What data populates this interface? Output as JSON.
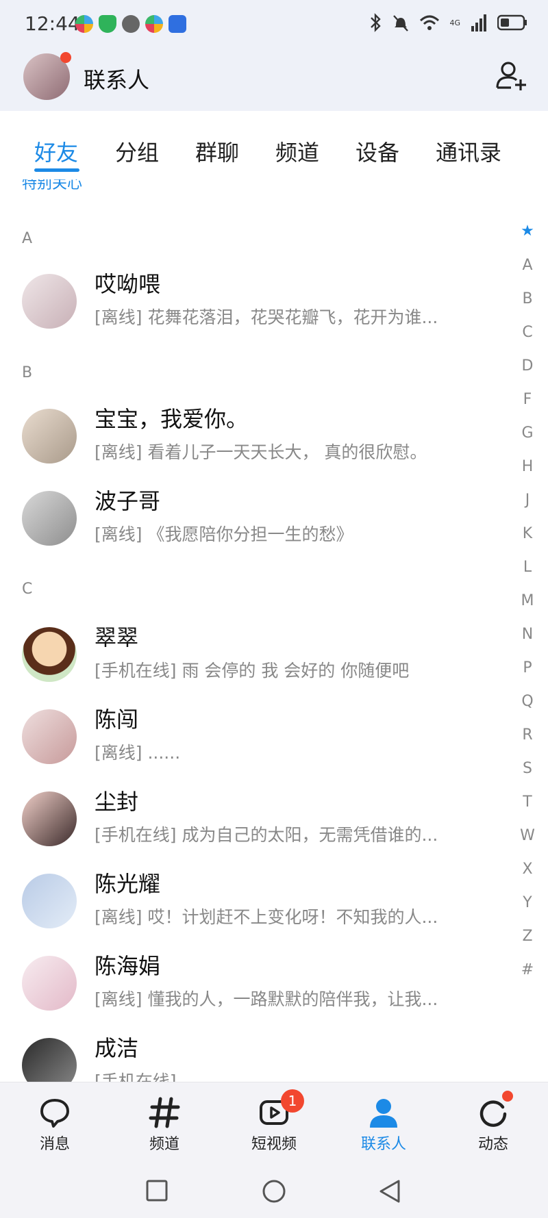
{
  "status_bar": {
    "time": "12:44",
    "network": "4G"
  },
  "header": {
    "title": "联系人"
  },
  "tabs": [
    "好友",
    "分组",
    "群聊",
    "频道",
    "设备",
    "通讯录"
  ],
  "partial_section": "特别关心",
  "sections": [
    {
      "letter": "A",
      "contacts": [
        {
          "name": "哎呦喂",
          "status": "[离线] 花舞花落泪，花哭花瓣飞，花开为谁..."
        }
      ]
    },
    {
      "letter": "B",
      "contacts": [
        {
          "name": "宝宝，我爱你。",
          "status": "[离线] 看着儿子一天天长大， 真的很欣慰。"
        },
        {
          "name": "波子哥",
          "status": "[离线] 《我愿陪你分担一生的愁》"
        }
      ]
    },
    {
      "letter": "C",
      "contacts": [
        {
          "name": "翠翠",
          "status": "[手机在线] 雨  会停的  我   会好的  你随便吧"
        },
        {
          "name": "陈闯",
          "status": "[离线] ......"
        },
        {
          "name": "尘封",
          "status": "[手机在线] 成为自己的太阳，无需凭借谁的..."
        },
        {
          "name": "陈光耀",
          "status": "[离线] 哎！计划赶不上变化呀！不知我的人..."
        },
        {
          "name": "陈海娟",
          "status": "[离线] 懂我的人，一路默默的陪伴我，让我..."
        },
        {
          "name": "成洁",
          "status": "[手机在线]"
        }
      ]
    }
  ],
  "index_letters": [
    "★",
    "A",
    "B",
    "C",
    "D",
    "F",
    "G",
    "H",
    "J",
    "K",
    "L",
    "M",
    "N",
    "P",
    "Q",
    "R",
    "S",
    "T",
    "W",
    "X",
    "Y",
    "Z",
    "#"
  ],
  "bottom_nav": [
    {
      "label": "消息",
      "icon": "message-icon"
    },
    {
      "label": "频道",
      "icon": "hash-icon"
    },
    {
      "label": "短视频",
      "icon": "video-icon",
      "badge": "1"
    },
    {
      "label": "联系人",
      "icon": "contacts-icon",
      "active": true
    },
    {
      "label": "动态",
      "icon": "activity-icon"
    }
  ],
  "colors": {
    "accent": "#1c8ae6",
    "badge": "#f2472f",
    "header_bg": "#eef1f8"
  }
}
